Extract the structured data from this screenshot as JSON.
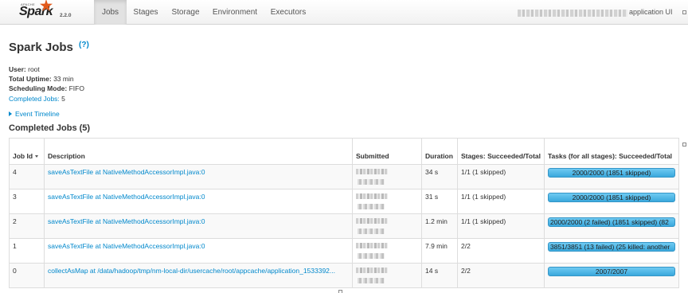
{
  "navbar": {
    "brand_top": "APACHE",
    "brand_name": "Spark",
    "version": "2.2.0",
    "tabs": [
      "Jobs",
      "Stages",
      "Storage",
      "Environment",
      "Executors"
    ],
    "active_tab": "Jobs",
    "app_label": "application UI"
  },
  "page": {
    "title": "Spark Jobs",
    "help": "(?)"
  },
  "summary": {
    "user_label": "User:",
    "user_value": "root",
    "uptime_label": "Total Uptime:",
    "uptime_value": "33 min",
    "mode_label": "Scheduling Mode:",
    "mode_value": "FIFO",
    "completed_label": "Completed Jobs:",
    "completed_value": "5"
  },
  "event_timeline": "Event Timeline",
  "section_title": "Completed Jobs (5)",
  "table": {
    "headers": {
      "job_id": "Job Id",
      "description": "Description",
      "submitted": "Submitted",
      "duration": "Duration",
      "stages": "Stages: Succeeded/Total",
      "tasks": "Tasks (for all stages): Succeeded/Total"
    },
    "rows": [
      {
        "job_id": "4",
        "description": "saveAsTextFile at NativeMethodAccessorImpl.java:0",
        "duration": "34 s",
        "stages": "1/1 (1 skipped)",
        "tasks": "2000/2000 (1851 skipped)",
        "progress": 1.0
      },
      {
        "job_id": "3",
        "description": "saveAsTextFile at NativeMethodAccessorImpl.java:0",
        "duration": "31 s",
        "stages": "1/1 (1 skipped)",
        "tasks": "2000/2000 (1851 skipped)",
        "progress": 1.0
      },
      {
        "job_id": "2",
        "description": "saveAsTextFile at NativeMethodAccessorImpl.java:0",
        "duration": "1.2 min",
        "stages": "1/1 (1 skipped)",
        "tasks": "2000/2000 (2 failed) (1851 skipped) (82",
        "progress": 1.0
      },
      {
        "job_id": "1",
        "description": "saveAsTextFile at NativeMethodAccessorImpl.java:0",
        "duration": "7.9 min",
        "stages": "2/2",
        "tasks": "3851/3851 (13 failed) (25 killed: another",
        "progress": 1.0
      },
      {
        "job_id": "0",
        "description": "collectAsMap at /data/hadoop/tmp/nm-local-dir/usercache/root/appcache/application_1533392...",
        "duration": "14 s",
        "stages": "2/2",
        "tasks": "2007/2007",
        "progress": 1.0
      }
    ]
  },
  "colors": {
    "link": "#0088cc",
    "progress_fill": "#3aa8dc",
    "brand_star": "#e25a1c"
  }
}
